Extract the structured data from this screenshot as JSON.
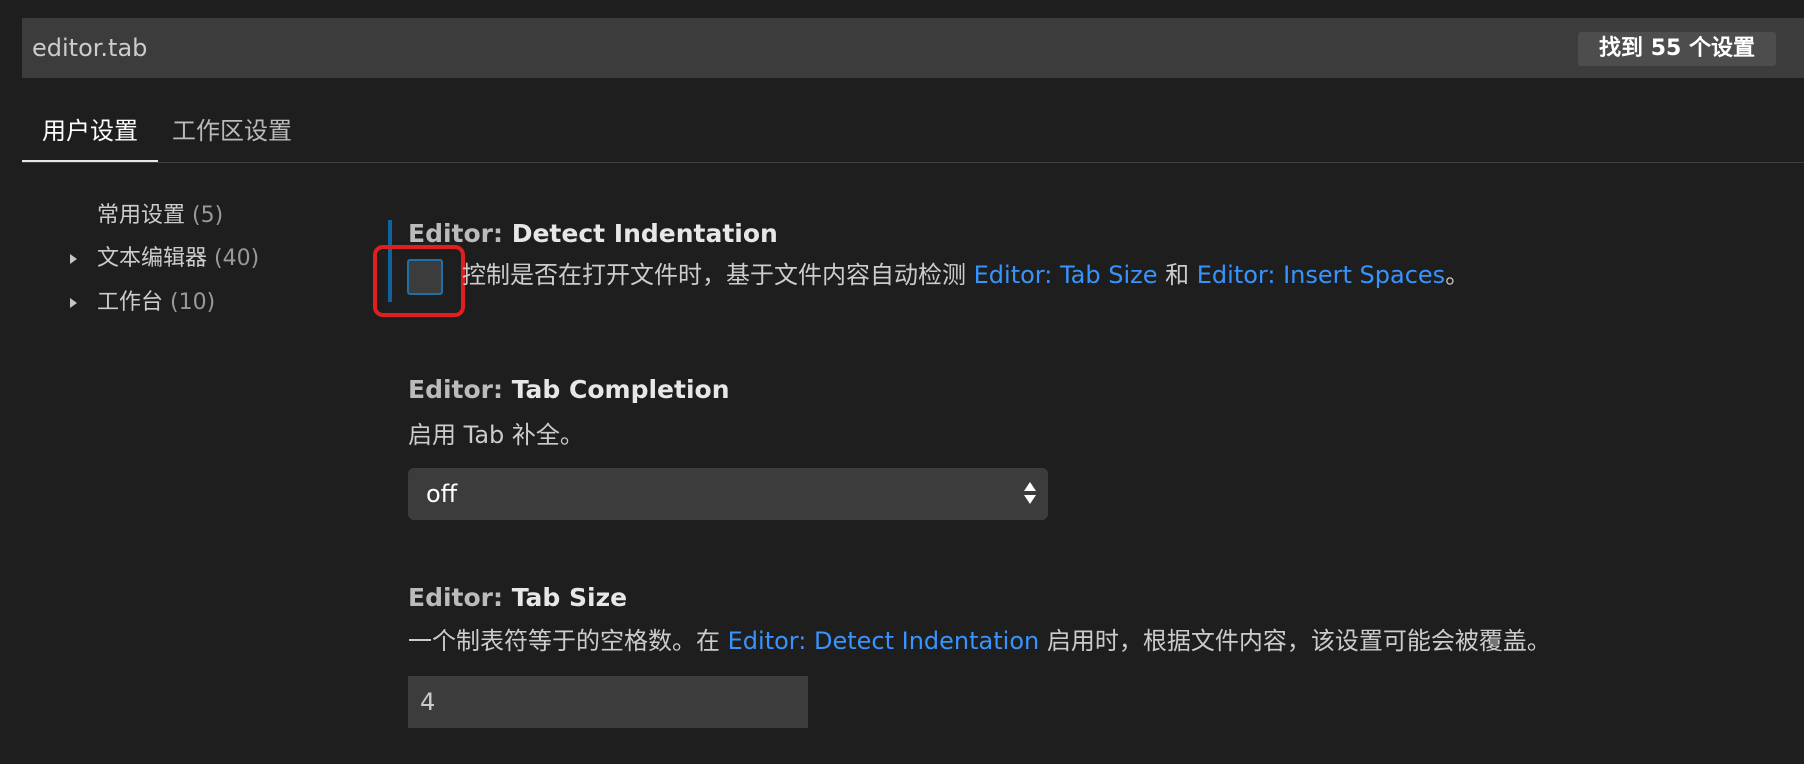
{
  "search": {
    "value": "editor.tab",
    "result_count": "找到 55 个设置"
  },
  "tabs": [
    {
      "label": "用户设置",
      "active": true
    },
    {
      "label": "工作区设置",
      "active": false
    }
  ],
  "toc": [
    {
      "label": "常用设置",
      "count": "(5)",
      "expandable": false
    },
    {
      "label": "文本编辑器",
      "count": "(40)",
      "expandable": true
    },
    {
      "label": "工作台",
      "count": "(10)",
      "expandable": true
    }
  ],
  "settings": [
    {
      "category": "Editor: ",
      "name": "Detect Indentation",
      "control": "checkbox",
      "checked": false,
      "desc_before": "控制是否在打开文件时，基于文件内容自动检测 ",
      "link1": "Editor: Tab Size",
      "desc_mid": " 和 ",
      "link2": "Editor: Insert Spaces",
      "desc_after": "。"
    },
    {
      "category": "Editor: ",
      "name": "Tab Completion",
      "control": "select",
      "desc": "启用 Tab 补全。",
      "value": "off"
    },
    {
      "category": "Editor: ",
      "name": "Tab Size",
      "control": "number",
      "desc_before": "一个制表符等于的空格数。在 ",
      "link": "Editor: Detect Indentation",
      "desc_after": " 启用时，根据文件内容，该设置可能会被覆盖。",
      "value": "4"
    }
  ],
  "colors": {
    "background": "#1e1e1e",
    "link": "#3794ff",
    "highlight": "#e02020",
    "focus": "#0e639c"
  }
}
